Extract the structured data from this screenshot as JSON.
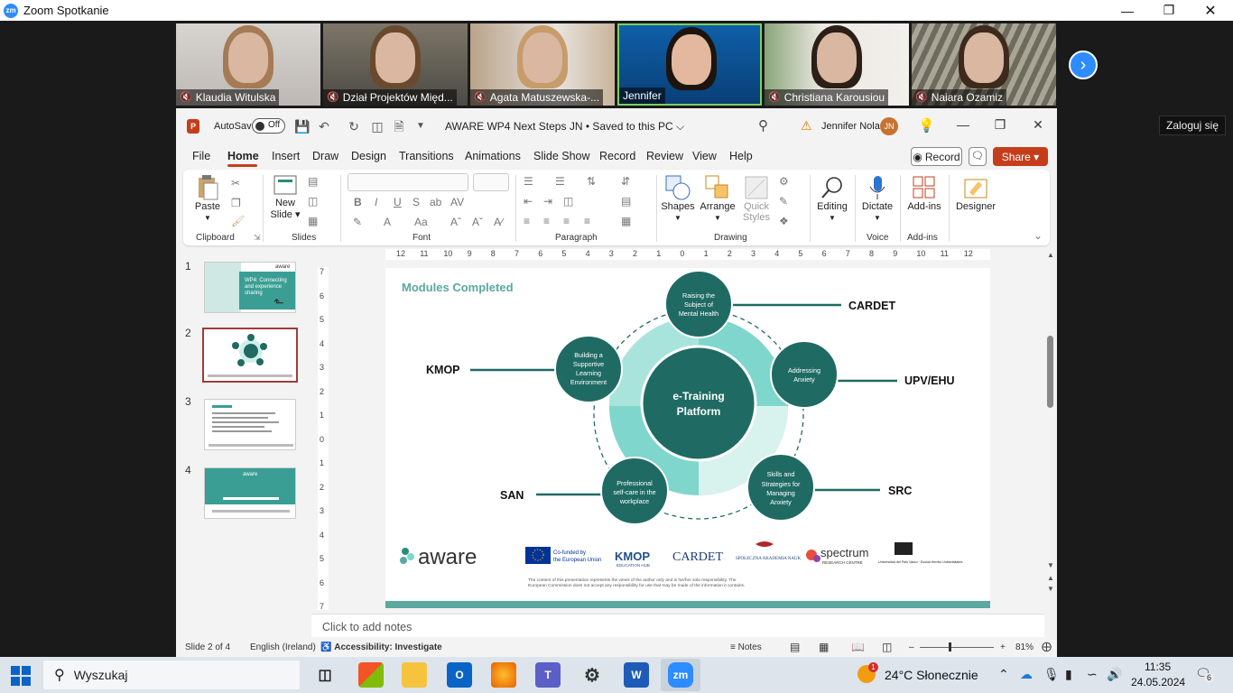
{
  "zoom": {
    "title": "Zoom Spotkanie",
    "logo_text": "zm",
    "participants": [
      {
        "name": "Klaudia Witulska",
        "muted": true
      },
      {
        "name": "Dział Projektów Międ...",
        "muted": true
      },
      {
        "name": "Agata Matuszewska-...",
        "muted": true
      },
      {
        "name": "Jennifer",
        "muted": false
      },
      {
        "name": "Christiana Karousiou",
        "muted": true
      },
      {
        "name": "Naiara Ozamiz",
        "muted": true
      }
    ],
    "sign_in_label": "Zaloguj się"
  },
  "ppt": {
    "logo_text": "P",
    "autosave_label": "AutoSave",
    "autosave_state": "Off",
    "doc_title": "AWARE WP4 Next Steps JN • Saved to this PC ⌵",
    "user_name": "Jennifer Nolan",
    "user_initials": "JN",
    "menu_tabs": [
      "File",
      "Home",
      "Insert",
      "Draw",
      "Design",
      "Transitions",
      "Animations",
      "Slide Show",
      "Record",
      "Review",
      "View",
      "Help"
    ],
    "record_label": "Record",
    "share_label": "Share",
    "ribbon": {
      "paste": "Paste",
      "clipboard": "Clipboard",
      "new_slide_1": "New",
      "new_slide_2": "Slide",
      "slides": "Slides",
      "font": "Font",
      "paragraph": "Paragraph",
      "shapes": "Shapes",
      "arrange": "Arrange",
      "quick_styles_1": "Quick",
      "quick_styles_2": "Styles",
      "drawing": "Drawing",
      "editing": "Editing",
      "dictate": "Dictate",
      "voice": "Voice",
      "addins_btn": "Add-ins",
      "addins": "Add-ins",
      "designer": "Designer"
    },
    "thumbnails": [
      "1",
      "2",
      "3",
      "4"
    ],
    "thumb1_text": "WP4: Connecting and experience sharing",
    "thumb1_logo": "aware",
    "thumb4_logo": "aware",
    "hruler": [
      "12",
      "11",
      "10",
      "9",
      "8",
      "7",
      "6",
      "5",
      "4",
      "3",
      "2",
      "1",
      "0",
      "1",
      "2",
      "3",
      "4",
      "5",
      "6",
      "7",
      "8",
      "9",
      "10",
      "11",
      "12"
    ],
    "vruler": [
      "7",
      "6",
      "5",
      "4",
      "3",
      "2",
      "1",
      "0",
      "1",
      "2",
      "3",
      "4",
      "5",
      "6",
      "7"
    ],
    "notes_placeholder": "Click to add notes",
    "status": {
      "slide_of": "Slide 2 of 4",
      "language": "English (Ireland)",
      "accessibility": "Accessibility: Investigate",
      "notes": "Notes",
      "zoom": "81%"
    }
  },
  "slide": {
    "title": "Modules Completed",
    "center": [
      "e-Training",
      "Platform"
    ],
    "modules": [
      {
        "lines": [
          "Raising the",
          "Subject of",
          "Mental Health"
        ],
        "partner": "CARDET"
      },
      {
        "lines": [
          "Addressing",
          "Anxiety"
        ],
        "partner": "UPV/EHU"
      },
      {
        "lines": [
          "Skills and",
          "Strategies for",
          "Managing",
          "Anxiety"
        ],
        "partner": "SRC"
      },
      {
        "lines": [
          "Professional",
          "self-care in the",
          "workplace"
        ],
        "partner": "SAN"
      },
      {
        "lines": [
          "Building a",
          "Supportive",
          "Learning",
          "Environment"
        ],
        "partner": "KMOP"
      }
    ],
    "logo_aware": "aware",
    "eu_line1": "Co-funded by",
    "eu_line2": "the European Union",
    "logo_kmop": "KMOP",
    "logo_kmop_sub": "EDUCATION HUB",
    "logo_cardet": "CARDET",
    "logo_san": "SPOŁECZNA AKADEMIA NAUK",
    "logo_spectrum": "spectrum",
    "logo_spectrum_sub": "RESEARCH CENTRE",
    "logo_upv": "Universidad del País Vasco · Euskal Herriko Unibertsitatea",
    "disclaimer_1": "The content of this presentation represents the views of the author only and is his/her sole responsibility. The",
    "disclaimer_2": "European Commission does not accept any responsibility for use that may be made of the information it contains."
  },
  "taskbar": {
    "search_placeholder": "Wyszukaj",
    "weather": "24°C  Słonecznie",
    "weather_badge": "1",
    "time": "11:35",
    "date": "24.05.2024",
    "notifications": "6"
  },
  "colors": {
    "teal_dark": "#1f6b63",
    "teal_light": "#7fd6cc",
    "ppt_accent": "#c43e1c",
    "zoom_blue": "#2d8cff"
  }
}
